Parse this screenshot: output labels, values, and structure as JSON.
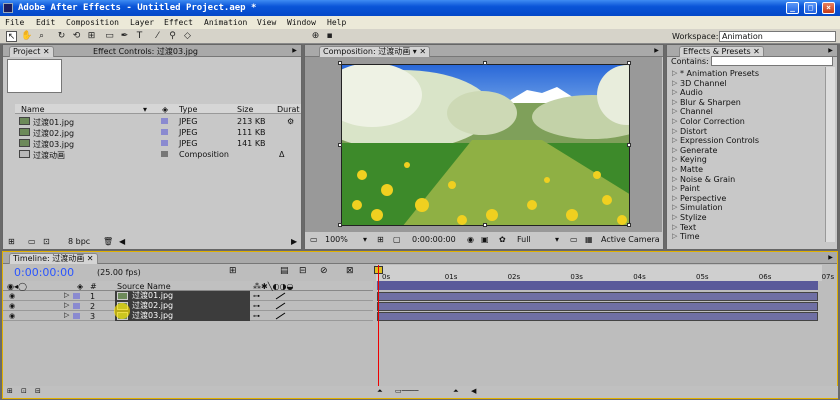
{
  "window": {
    "title": "Adobe After Effects - Untitled Project.aep *",
    "buttons": [
      "_",
      "□",
      "×"
    ]
  },
  "menu": [
    "File",
    "Edit",
    "Composition",
    "Layer",
    "Effect",
    "Animation",
    "View",
    "Window",
    "Help"
  ],
  "toolbar": {
    "workspace_label": "Workspace:",
    "workspace_value": "Animation"
  },
  "project_panel": {
    "tabs": [
      "Project",
      "Effect Controls: 过渡03.jpg"
    ],
    "columns": [
      "Name",
      "Type",
      "Size",
      "Durat"
    ],
    "items": [
      {
        "name": "过渡01.jpg",
        "type": "JPEG",
        "size": "213 KB",
        "kind": "image"
      },
      {
        "name": "过渡02.jpg",
        "type": "JPEG",
        "size": "111 KB",
        "kind": "image"
      },
      {
        "name": "过渡03.jpg",
        "type": "JPEG",
        "size": "141 KB",
        "kind": "image"
      },
      {
        "name": "过渡动画",
        "type": "Composition",
        "size": "",
        "kind": "comp",
        "dur": "Δ"
      }
    ],
    "footer_bpc": "8 bpc"
  },
  "composition_panel": {
    "tab": "Composition: 过渡动画",
    "zoom": "100%",
    "timecode": "0:00:00:00",
    "resolution": "Full",
    "camera": "Active Camera"
  },
  "effects_panel": {
    "tab": "Effects & Presets",
    "contains_label": "Contains:",
    "items": [
      "* Animation Presets",
      "3D Channel",
      "Audio",
      "Blur & Sharpen",
      "Channel",
      "Color Correction",
      "Distort",
      "Expression Controls",
      "Generate",
      "Keying",
      "Matte",
      "Noise & Grain",
      "Paint",
      "Perspective",
      "Simulation",
      "Stylize",
      "Text",
      "Time"
    ]
  },
  "timeline_panel": {
    "tab": "Timeline: 过渡动画",
    "timecode": "0:00:00:00",
    "fps": "(25.00 fps)",
    "col_num": "#",
    "col_source": "Source Name",
    "ruler_ticks": [
      "0s",
      "01s",
      "02s",
      "03s",
      "04s",
      "05s",
      "06s",
      "07s"
    ],
    "layers": [
      {
        "num": "1",
        "name": "过渡01.jpg"
      },
      {
        "num": "2",
        "name": "过渡02.jpg"
      },
      {
        "num": "3",
        "name": "过渡03.jpg"
      }
    ]
  },
  "colors": {
    "title_blue": "#0a55d8",
    "timecode_blue": "#2a55ff",
    "layer_bar": "#6f6fa4",
    "cti_red": "#e00000",
    "label_violet": "#8a8ad0"
  }
}
